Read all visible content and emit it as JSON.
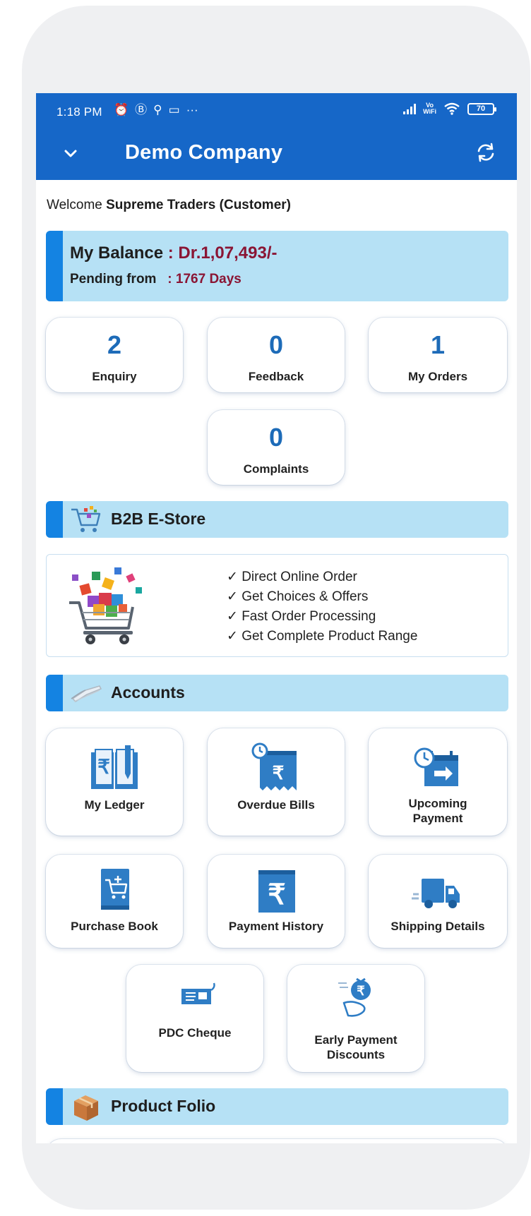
{
  "status_bar": {
    "time": "1:18 PM",
    "battery": "70",
    "vowifi_top": "Vo",
    "vowifi_bottom": "WiFi"
  },
  "header": {
    "title": "Demo Company",
    "left_icon": "chevron-down-icon",
    "right_icon": "refresh-icon"
  },
  "welcome": {
    "prefix": "Welcome",
    "name": "Supreme Traders (Customer)"
  },
  "balance": {
    "label": "My Balance",
    "value": ": Dr.1,07,493/-",
    "pending_label": "Pending from",
    "pending_value": ": 1767 Days"
  },
  "stats": [
    {
      "value": "2",
      "label": "Enquiry"
    },
    {
      "value": "0",
      "label": "Feedback"
    },
    {
      "value": "1",
      "label": "My Orders"
    },
    {
      "value": "0",
      "label": "Complaints"
    }
  ],
  "estore": {
    "section_title": "B2B E-Store",
    "features": [
      "✓ Direct Online Order",
      "✓ Get Choices & Offers",
      "✓ Fast Order Processing",
      "✓ Get Complete Product Range"
    ]
  },
  "accounts": {
    "section_title": "Accounts",
    "tiles": [
      {
        "label": "My Ledger",
        "icon": "ledger-book-icon"
      },
      {
        "label": "Overdue Bills",
        "icon": "overdue-bill-icon"
      },
      {
        "label_line1": "Upcoming",
        "label_line2": "Payment",
        "icon": "upcoming-payment-icon"
      },
      {
        "label": "Purchase Book",
        "icon": "purchase-book-icon"
      },
      {
        "label": "Payment History",
        "icon": "payment-history-icon"
      },
      {
        "label": "Shipping Details",
        "icon": "delivery-truck-icon"
      },
      {
        "label": "PDC Cheque",
        "icon": "cheque-icon"
      },
      {
        "label_line1": "Early Payment",
        "label_line2": "Discounts",
        "icon": "money-bag-hand-icon"
      }
    ]
  },
  "product_folio": {
    "section_title": "Product Folio"
  },
  "colors": {
    "appbar": "#1667c8",
    "section_bg": "#b6e1f5",
    "section_accent": "#1483e2",
    "stat_number": "#1d6bb8",
    "amount": "#8a1534"
  }
}
